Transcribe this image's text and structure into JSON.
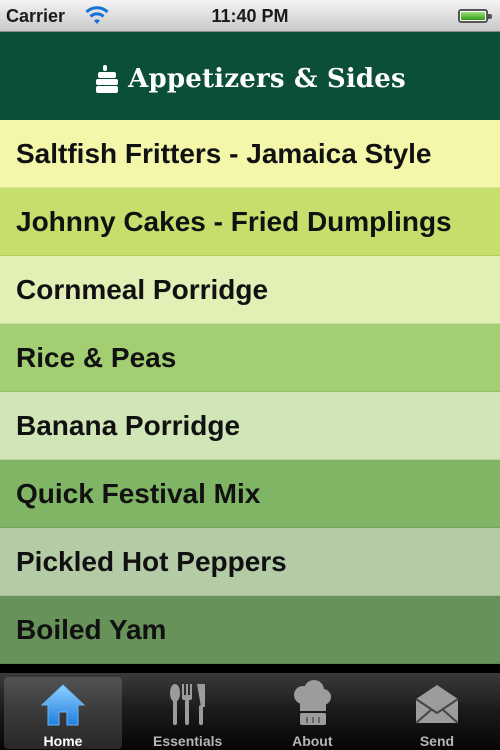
{
  "status_bar": {
    "carrier": "Carrier",
    "time": "11:40 PM"
  },
  "header": {
    "title": "Appetizers & Sides",
    "icon": "cake-icon"
  },
  "rows": [
    {
      "label": "Saltfish Fritters - Jamaica Style",
      "color": "#f4f7a9"
    },
    {
      "label": "Johnny Cakes - Fried Dumplings",
      "color": "#c6de6c"
    },
    {
      "label": "Cornmeal Porridge",
      "color": "#e2f0b5"
    },
    {
      "label": "Rice & Peas",
      "color": "#a3cf72"
    },
    {
      "label": "Banana Porridge",
      "color": "#d0e6b7"
    },
    {
      "label": "Quick Festival Mix",
      "color": "#7fb565"
    },
    {
      "label": "Pickled Hot Peppers",
      "color": "#b4cca6"
    },
    {
      "label": "Boiled Yam",
      "color": "#67925a"
    }
  ],
  "tabs": [
    {
      "label": "Home",
      "icon": "home-icon",
      "selected": true
    },
    {
      "label": "Essentials",
      "icon": "utensils-icon",
      "selected": false
    },
    {
      "label": "About",
      "icon": "chef-hat-icon",
      "selected": false
    },
    {
      "label": "Send",
      "icon": "envelope-icon",
      "selected": false
    }
  ],
  "colors": {
    "header_bg": "#0c4f38",
    "tab_highlight": "#4aa3f0"
  }
}
